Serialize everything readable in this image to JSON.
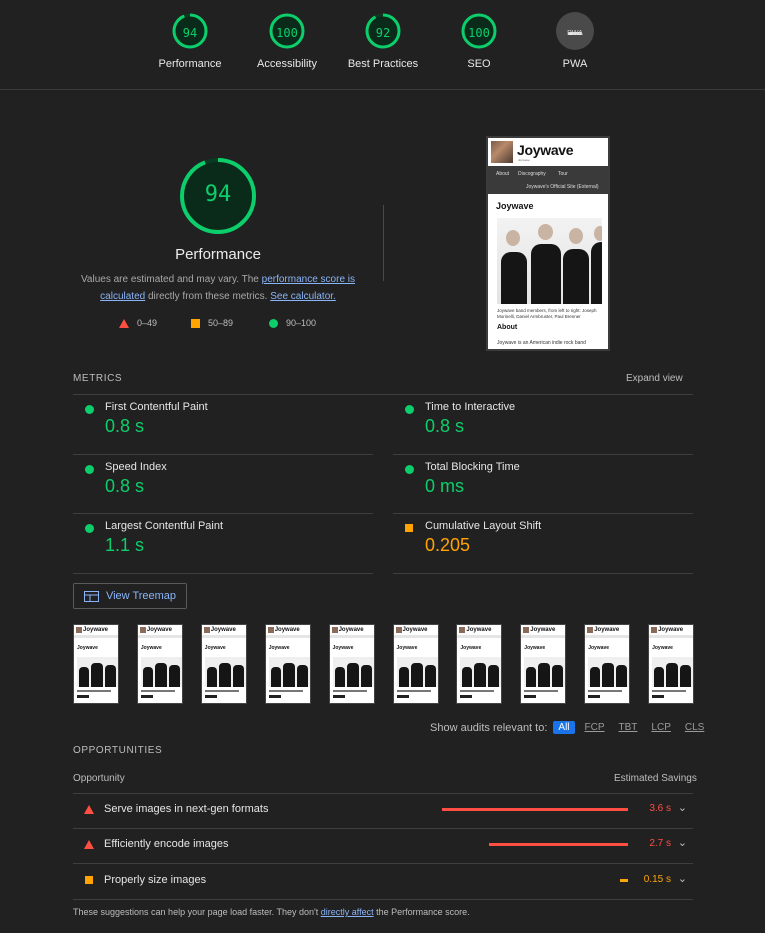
{
  "colors": {
    "pass": "#0cce6b",
    "average": "#ffa400",
    "fail": "#ff4e42",
    "background": "#212121",
    "link": "#8ab4f8"
  },
  "top_gauges": [
    {
      "value": "94",
      "label": "Performance",
      "score": 94
    },
    {
      "value": "100",
      "label": "Accessibility",
      "score": 100
    },
    {
      "value": "92",
      "label": "Best Practices",
      "score": 92
    },
    {
      "value": "100",
      "label": "SEO",
      "score": 100
    },
    {
      "value": "PWA",
      "label": "PWA",
      "icon": "pwa-badge-icon"
    }
  ],
  "performance": {
    "score": "94",
    "score_fraction": 0.94,
    "title": "Performance",
    "note_prefix": "Values are estimated and may vary. The ",
    "note_link1": "performance score is calculated",
    "note_middle": " directly from these metrics. ",
    "note_link2": "See calculator.",
    "legend": [
      {
        "icon": "triangle-icon",
        "label": "0–49"
      },
      {
        "icon": "square-icon",
        "label": "50–89"
      },
      {
        "icon": "circle-icon",
        "label": "90–100"
      }
    ]
  },
  "screenshot": {
    "brand": "Joywave",
    "brand_sub": "Joywave",
    "nav": [
      "About",
      "Discography",
      "Tour"
    ],
    "nav_external": "Joywave's Official Site (External)",
    "heading": "Joywave",
    "caption": "Joywave band members, from left to right: Joseph Morinelli, Daniel Armbruster, Paul Brenner",
    "about": "About",
    "body": "Joywave is an American indie rock band"
  },
  "metrics": {
    "title": "METRICS",
    "expand": "Expand view",
    "items": [
      {
        "name": "First Contentful Paint",
        "value": "0.8 s",
        "status": "pass"
      },
      {
        "name": "Time to Interactive",
        "value": "0.8 s",
        "status": "pass"
      },
      {
        "name": "Speed Index",
        "value": "0.8 s",
        "status": "pass"
      },
      {
        "name": "Total Blocking Time",
        "value": "0 ms",
        "status": "pass"
      },
      {
        "name": "Largest Contentful Paint",
        "value": "1.1 s",
        "status": "pass"
      },
      {
        "name": "Cumulative Layout Shift",
        "value": "0.205",
        "status": "average"
      }
    ]
  },
  "treemap": {
    "label": "View Treemap",
    "icon": "treemap-icon"
  },
  "filmstrip": {
    "frame_count": 10,
    "brand": "Joywave",
    "heading": "Joywave"
  },
  "filters": {
    "label": "Show audits relevant to:",
    "options": [
      "All",
      "FCP",
      "TBT",
      "LCP",
      "CLS"
    ],
    "active": "All"
  },
  "opportunities": {
    "title": "OPPORTUNITIES",
    "col_left": "Opportunity",
    "col_right": "Estimated Savings",
    "items": [
      {
        "title": "Serve images in next-gen formats",
        "savings": "3.6 s",
        "status": "fail",
        "savings_seconds": 3.6
      },
      {
        "title": "Efficiently encode images",
        "savings": "2.7 s",
        "status": "fail",
        "savings_seconds": 2.7
      },
      {
        "title": "Properly size images",
        "savings": "0.15 s",
        "status": "average",
        "savings_seconds": 0.15
      }
    ],
    "footer_prefix": "These suggestions can help your page load faster. They don't ",
    "footer_link": "directly affect",
    "footer_suffix": " the Performance score."
  }
}
